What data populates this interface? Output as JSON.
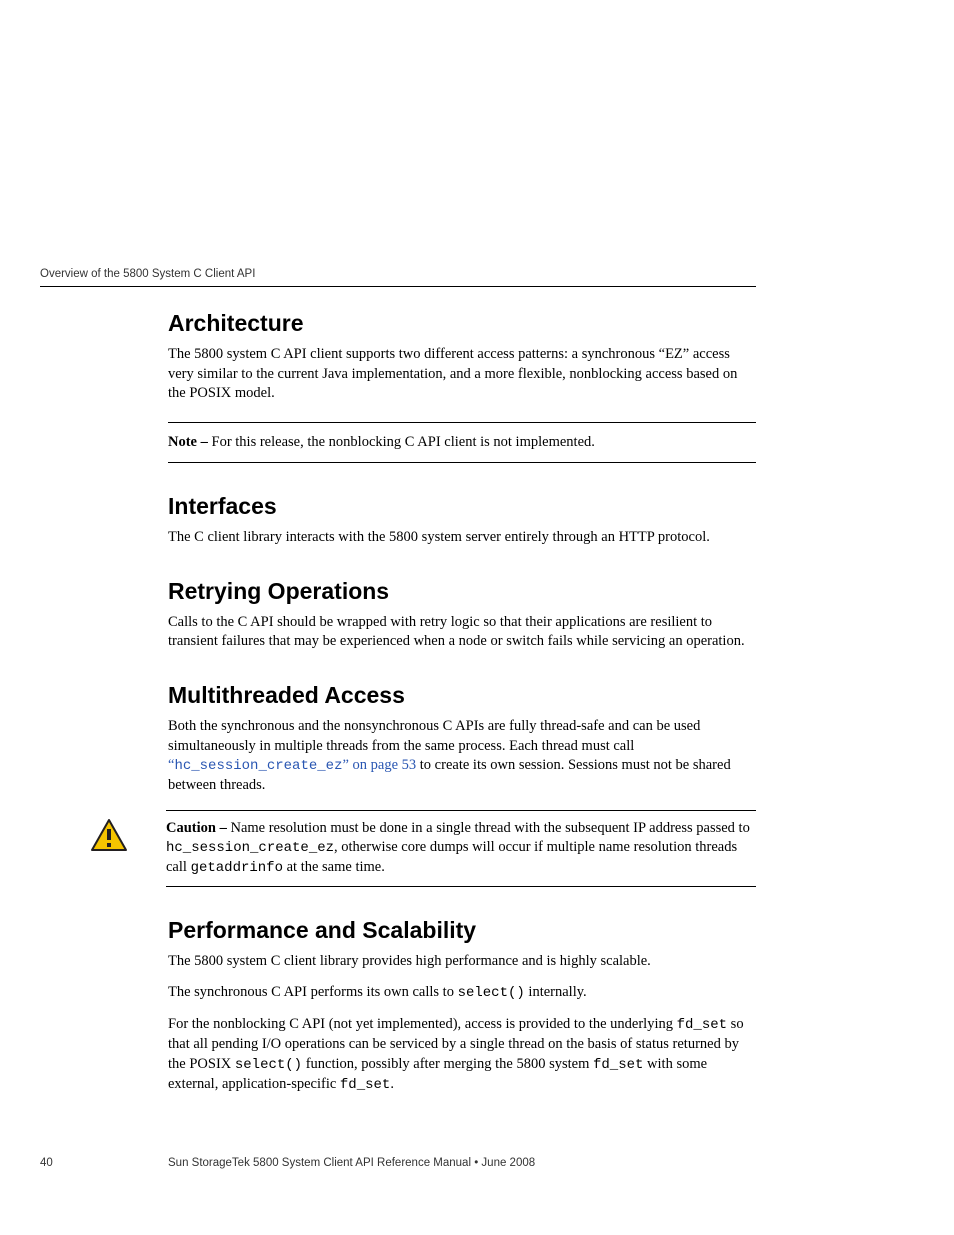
{
  "running_head": "Overview of the 5800 System C Client API",
  "sections": {
    "s0": {
      "title": "Architecture",
      "p0": "The 5800 system C API client supports two different access patterns: a synchronous “EZ” access very similar to the current Java implementation, and a more flexible, nonblocking access based on the POSIX model.",
      "note_label": "Note – ",
      "note_text": "For this release, the nonblocking C API client is not implemented."
    },
    "s1": {
      "title": "Interfaces",
      "p0": "The C client library interacts with the 5800 system server entirely through an HTTP protocol."
    },
    "s2": {
      "title": "Retrying Operations",
      "p0": "Calls to the C API should be wrapped with retry logic so that their applications are resilient to transient failures that may be experienced when a node or switch fails while servicing an operation."
    },
    "s3": {
      "title": "Multithreaded Access",
      "p0_a": "Both the synchronous and the nonsynchronous C APIs are fully thread-safe and can be used simultaneously in multiple threads from the same process. Each thread must call ",
      "link_pre": "“",
      "link_code": "hc_session_create_ez",
      "link_post": "” on page 53",
      "p0_b": " to create its own session. Sessions must not be shared between threads.",
      "caution_label": "Caution – ",
      "caution_a": "Name resolution must be done in a single thread with the subsequent IP address passed to ",
      "caution_code1": "hc_session_create_ez",
      "caution_b": ", otherwise core dumps will occur if multiple name resolution threads call ",
      "caution_code2": "getaddrinfo",
      "caution_c": " at the same time."
    },
    "s4": {
      "title": "Performance and Scalability",
      "p0": "The 5800 system C client library provides high performance and is highly scalable.",
      "p1_a": "The synchronous C API performs its own calls to ",
      "p1_code": "select()",
      "p1_b": " internally.",
      "p2_a": "For the nonblocking C API (not yet implemented), access is provided to the underlying ",
      "p2_code1": "fd_set",
      "p2_b": " so that all pending I/O operations can be serviced by a single thread on the basis of status returned by the POSIX ",
      "p2_code2": "select()",
      "p2_c": " function, possibly after merging the 5800 system ",
      "p2_code3": "fd_set",
      "p2_d": " with some external, application-specific ",
      "p2_code4": "fd_set",
      "p2_e": "."
    }
  },
  "footer": {
    "page_number": "40",
    "doc_title": "Sun StorageTek 5800 System Client API Reference Manual • June 2008"
  },
  "icons": {
    "caution": "caution-triangle"
  },
  "colors": {
    "link": "#2956B2",
    "caution_fill": "#F5C400",
    "caution_stroke": "#231F20"
  }
}
